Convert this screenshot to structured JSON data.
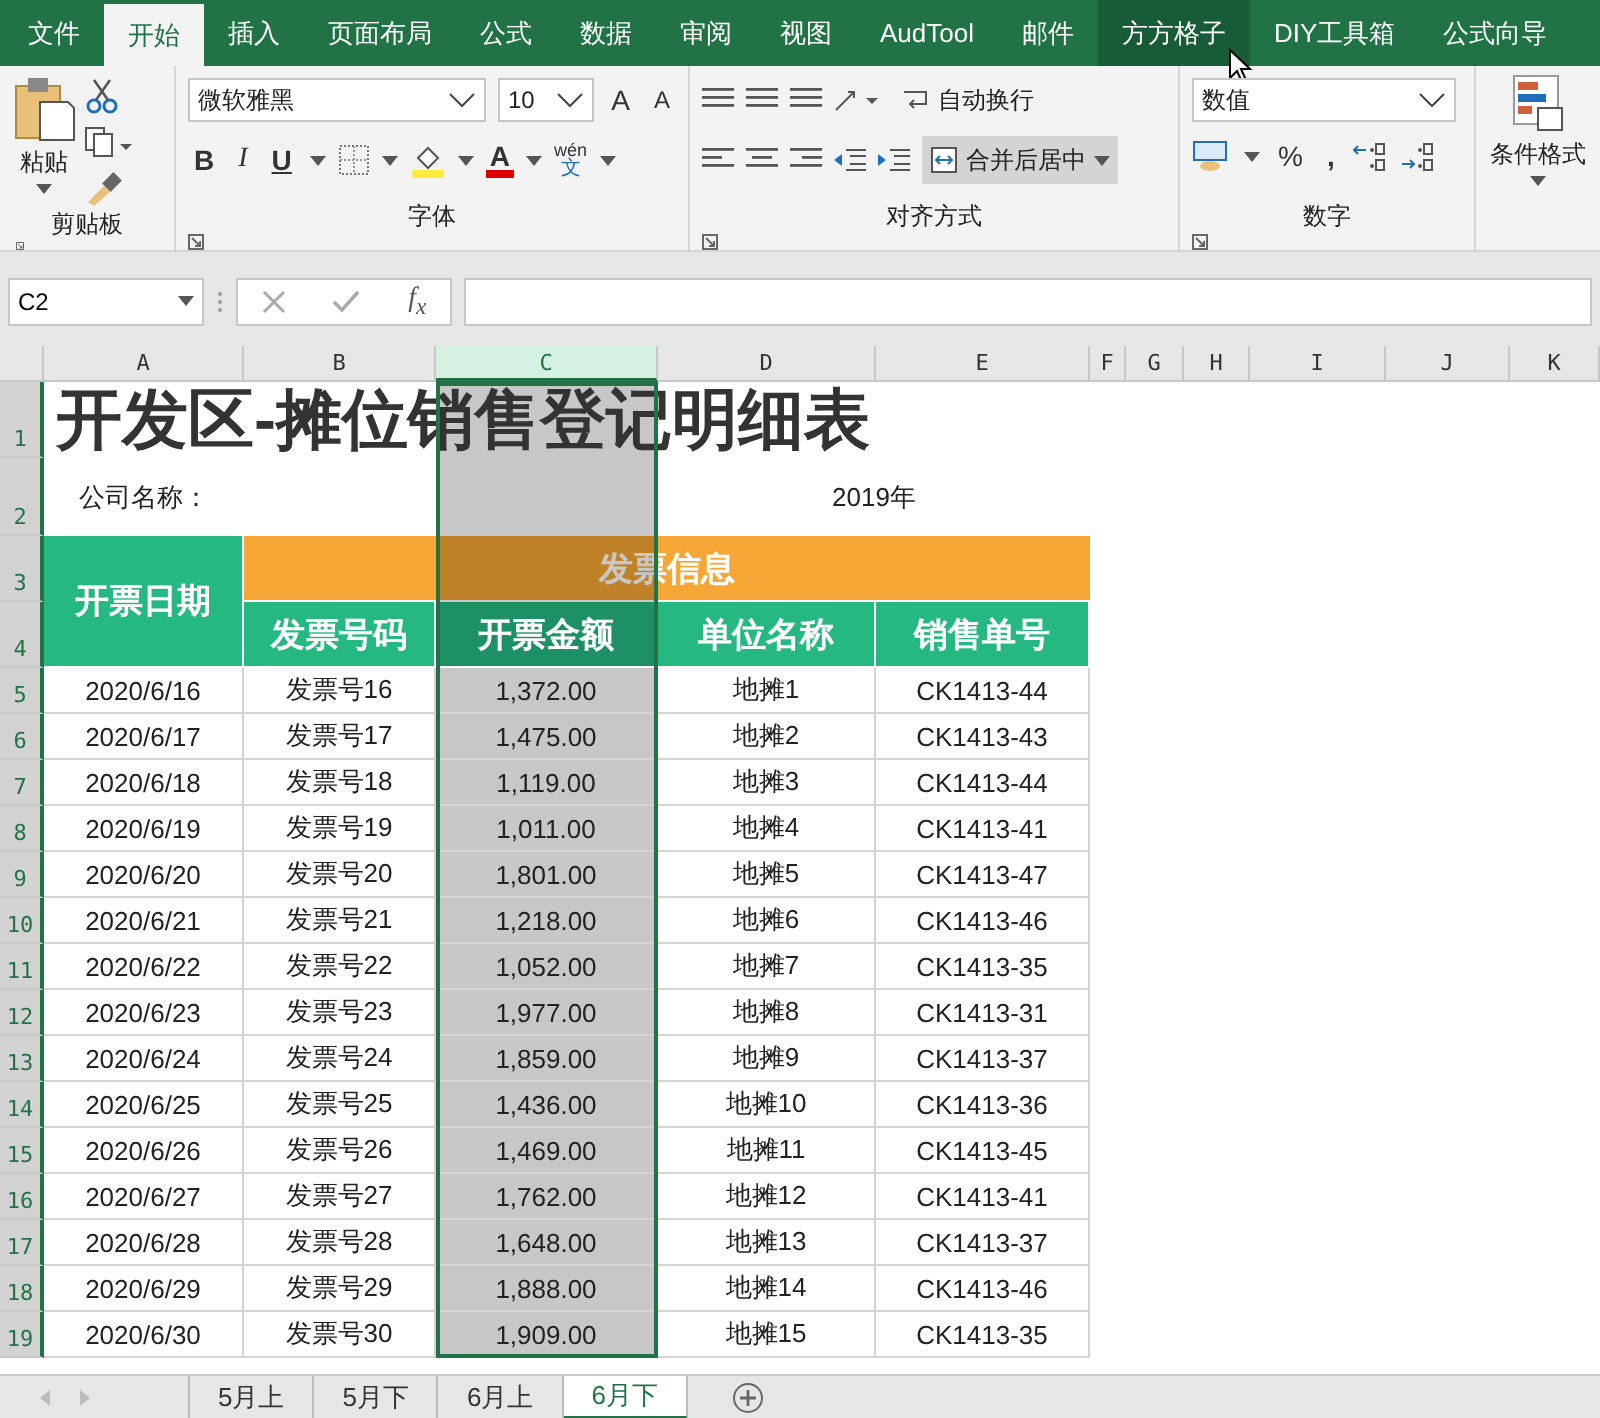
{
  "menu_tabs": [
    {
      "label": "文件",
      "selected": false,
      "hover": false
    },
    {
      "label": "开始",
      "selected": true,
      "hover": false
    },
    {
      "label": "插入",
      "selected": false,
      "hover": false
    },
    {
      "label": "页面布局",
      "selected": false,
      "hover": false
    },
    {
      "label": "公式",
      "selected": false,
      "hover": false
    },
    {
      "label": "数据",
      "selected": false,
      "hover": false
    },
    {
      "label": "审阅",
      "selected": false,
      "hover": false
    },
    {
      "label": "视图",
      "selected": false,
      "hover": false
    },
    {
      "label": "AudTool",
      "selected": false,
      "hover": false
    },
    {
      "label": "邮件",
      "selected": false,
      "hover": false
    },
    {
      "label": "方方格子",
      "selected": false,
      "hover": true
    },
    {
      "label": "DIY工具箱",
      "selected": false,
      "hover": false
    },
    {
      "label": "公式向导",
      "selected": false,
      "hover": false
    }
  ],
  "ribbon": {
    "paste": "粘贴",
    "clipboard_group": "剪贴板",
    "font_name": "微软雅黑",
    "font_size": "10",
    "grow_font": "A",
    "shrink_font": "A",
    "bold": "B",
    "italic": "I",
    "underline": "U",
    "font_color": "A",
    "phonetic_top": "wén",
    "phonetic_bottom": "文",
    "font_group": "字体",
    "wrap_text": "自动换行",
    "merge_center": "合并后居中",
    "align_group": "对齐方式",
    "number_format": "数值",
    "percent": "%",
    "comma": ",",
    "number_group": "数字",
    "conditional_format": "条件格式"
  },
  "formula_bar": {
    "name_box": "C2",
    "fx": "f$_{x}$"
  },
  "sheet": {
    "columns": [
      {
        "label": "A",
        "selected": false
      },
      {
        "label": "B",
        "selected": false
      },
      {
        "label": "C",
        "selected": true
      },
      {
        "label": "D",
        "selected": false
      },
      {
        "label": "E",
        "selected": false
      },
      {
        "label": "F",
        "selected": false
      },
      {
        "label": "G",
        "selected": false
      },
      {
        "label": "H",
        "selected": false
      },
      {
        "label": "I",
        "selected": false
      },
      {
        "label": "J",
        "selected": false
      },
      {
        "label": "K",
        "selected": false
      }
    ],
    "rows": [
      {
        "label": "1",
        "selected": true
      },
      {
        "label": "2",
        "selected": true
      },
      {
        "label": "3",
        "selected": true
      },
      {
        "label": "4",
        "selected": true
      },
      {
        "label": "5",
        "selected": true
      },
      {
        "label": "6",
        "selected": true
      },
      {
        "label": "7",
        "selected": true
      },
      {
        "label": "8",
        "selected": true
      },
      {
        "label": "9",
        "selected": true
      },
      {
        "label": "10",
        "selected": true
      },
      {
        "label": "11",
        "selected": true
      },
      {
        "label": "12",
        "selected": true
      },
      {
        "label": "13",
        "selected": true
      },
      {
        "label": "14",
        "selected": true
      },
      {
        "label": "15",
        "selected": true
      },
      {
        "label": "16",
        "selected": true
      },
      {
        "label": "17",
        "selected": true
      },
      {
        "label": "18",
        "selected": true
      },
      {
        "label": "19",
        "selected": true
      }
    ],
    "title": "开发区-摊位销售登记明细表",
    "company_label": "公司名称：",
    "year": "2019年",
    "date_header": "开票日期",
    "group_header": "发票信息",
    "headers": [
      "发票号码",
      "开票金额",
      "单位名称",
      "销售单号"
    ],
    "records": [
      [
        "2020/6/16",
        "发票号16",
        "1,372.00",
        "地摊1",
        "CK1413-44"
      ],
      [
        "2020/6/17",
        "发票号17",
        "1,475.00",
        "地摊2",
        "CK1413-43"
      ],
      [
        "2020/6/18",
        "发票号18",
        "1,119.00",
        "地摊3",
        "CK1413-44"
      ],
      [
        "2020/6/19",
        "发票号19",
        "1,011.00",
        "地摊4",
        "CK1413-41"
      ],
      [
        "2020/6/20",
        "发票号20",
        "1,801.00",
        "地摊5",
        "CK1413-47"
      ],
      [
        "2020/6/21",
        "发票号21",
        "1,218.00",
        "地摊6",
        "CK1413-46"
      ],
      [
        "2020/6/22",
        "发票号22",
        "1,052.00",
        "地摊7",
        "CK1413-35"
      ],
      [
        "2020/6/23",
        "发票号23",
        "1,977.00",
        "地摊8",
        "CK1413-31"
      ],
      [
        "2020/6/24",
        "发票号24",
        "1,859.00",
        "地摊9",
        "CK1413-37"
      ],
      [
        "2020/6/25",
        "发票号25",
        "1,436.00",
        "地摊10",
        "CK1413-36"
      ],
      [
        "2020/6/26",
        "发票号26",
        "1,469.00",
        "地摊11",
        "CK1413-45"
      ],
      [
        "2020/6/27",
        "发票号27",
        "1,762.00",
        "地摊12",
        "CK1413-41"
      ],
      [
        "2020/6/28",
        "发票号28",
        "1,648.00",
        "地摊13",
        "CK1413-37"
      ],
      [
        "2020/6/29",
        "发票号29",
        "1,888.00",
        "地摊14",
        "CK1413-46"
      ],
      [
        "2020/6/30",
        "发票号30",
        "1,909.00",
        "地摊15",
        "CK1413-35"
      ]
    ]
  },
  "sheet_tabs": [
    {
      "label": "5月上",
      "selected": false
    },
    {
      "label": "5月下",
      "selected": false
    },
    {
      "label": "6月上",
      "selected": false
    },
    {
      "label": "6月下",
      "selected": true
    }
  ]
}
